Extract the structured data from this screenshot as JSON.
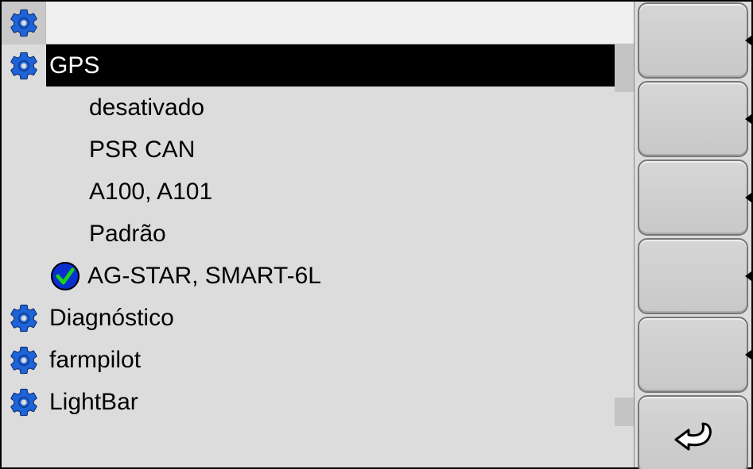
{
  "header": {},
  "menu": {
    "sections": [
      {
        "id": "gps",
        "label": "GPS",
        "selected": true,
        "items": [
          {
            "label": "desativado",
            "checked": false
          },
          {
            "label": "PSR CAN",
            "checked": false
          },
          {
            "label": "A100, A101",
            "checked": false
          },
          {
            "label": "Padrão",
            "checked": false
          },
          {
            "label": "AG-STAR, SMART-6L",
            "checked": true
          }
        ]
      },
      {
        "id": "diagnostico",
        "label": "Diagnóstico",
        "selected": false,
        "items": []
      },
      {
        "id": "farmpilot",
        "label": "farmpilot",
        "selected": false,
        "items": []
      },
      {
        "id": "lightbar",
        "label": "LightBar",
        "selected": false,
        "items": []
      }
    ]
  },
  "sidebar": {
    "buttons": [
      {
        "id": "btn1",
        "icon": null
      },
      {
        "id": "btn2",
        "icon": null
      },
      {
        "id": "btn3",
        "icon": null
      },
      {
        "id": "btn4",
        "icon": null
      },
      {
        "id": "btn5",
        "icon": null
      },
      {
        "id": "back",
        "icon": "back"
      }
    ]
  }
}
